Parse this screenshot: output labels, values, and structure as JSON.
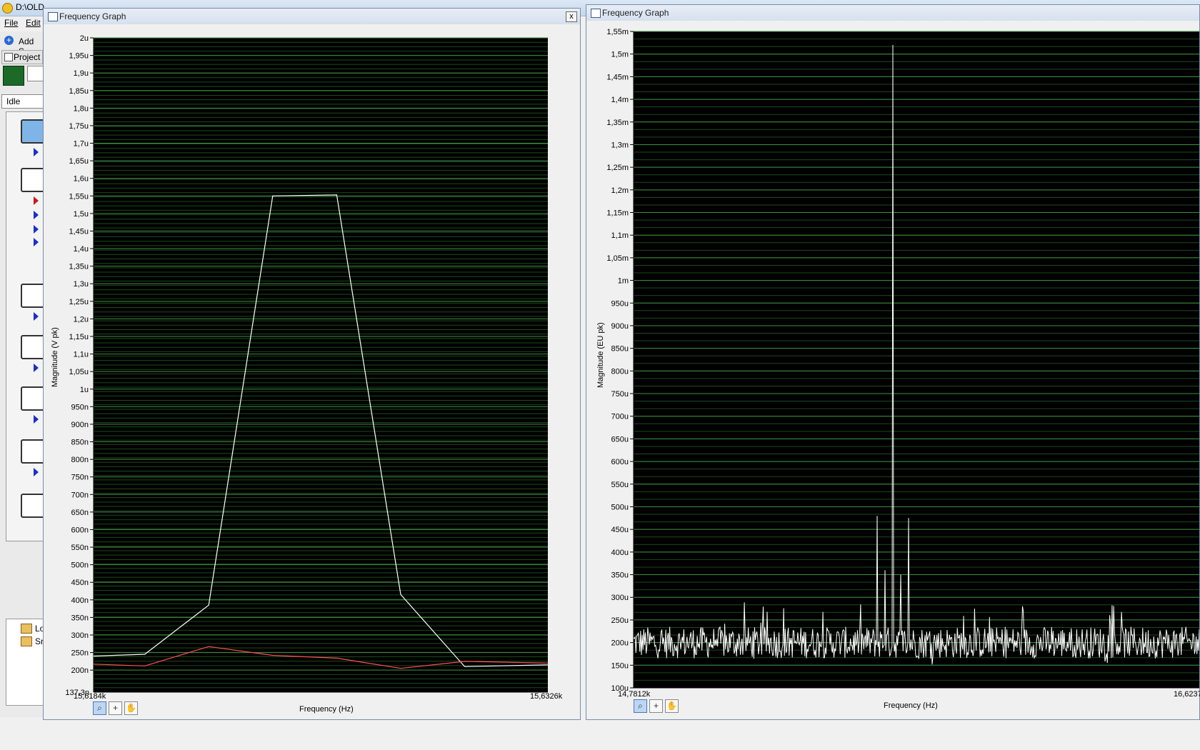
{
  "background_app": {
    "title": "D:\\OLD",
    "menu": [
      "File",
      "Edit"
    ],
    "add_button": "Add S",
    "project_tab": "Project",
    "status": "Idle",
    "tree_items": [
      "Lo",
      "Sn"
    ]
  },
  "left_window": {
    "title": "Frequency Graph",
    "close_label": "x",
    "ylabel": "Magnitude (V pk)",
    "xlabel": "Frequency (Hz)",
    "x_start_label": "15,6184k",
    "x_end_label": "15,6326k",
    "y_min_label": "137,3n",
    "tools": [
      "zoom-icon",
      "crosshair-icon",
      "hand-icon"
    ]
  },
  "right_window": {
    "title": "Frequency Graph",
    "ylabel": "Magnitude (EU pk)",
    "xlabel": "Frequency (Hz)",
    "x_start_label": "14,7812k",
    "x_end_label": "16,6237",
    "tools": [
      "zoom-icon",
      "crosshair-icon",
      "hand-icon"
    ]
  },
  "chart_data": [
    {
      "type": "line",
      "title": "Frequency Graph",
      "xlabel": "Frequency (Hz)",
      "ylabel": "Magnitude (V pk)",
      "xlim": [
        15618.4,
        15632.6
      ],
      "ylim": [
        1.373e-07,
        2e-06
      ],
      "grid": true,
      "ytick_labels": [
        "2u",
        "1,95u",
        "1,9u",
        "1,85u",
        "1,8u",
        "1,75u",
        "1,7u",
        "1,65u",
        "1,6u",
        "1,55u",
        "1,5u",
        "1,45u",
        "1,4u",
        "1,35u",
        "1,3u",
        "1,25u",
        "1,2u",
        "1,15u",
        "1,1u",
        "1,05u",
        "1u",
        "950n",
        "900n",
        "850n",
        "800n",
        "750n",
        "700n",
        "650n",
        "600n",
        "550n",
        "500n",
        "450n",
        "400n",
        "350n",
        "300n",
        "250n",
        "200n"
      ],
      "series": [
        {
          "color": "#ffffff",
          "x": [
            15618.4,
            15620.0,
            15622.0,
            15624.0,
            15626.0,
            15628.0,
            15630.0,
            15632.6
          ],
          "y": [
            2.4e-07,
            2.45e-07,
            3.85e-07,
            1.55e-06,
            1.553e-06,
            4.15e-07,
            2.1e-07,
            2.15e-07
          ]
        },
        {
          "color": "#ff5050",
          "x": [
            15618.4,
            15620.0,
            15622.0,
            15624.0,
            15626.0,
            15628.0,
            15630.0,
            15632.6
          ],
          "y": [
            2.17e-07,
            2.12e-07,
            2.67e-07,
            2.42e-07,
            2.34e-07,
            2.05e-07,
            2.25e-07,
            2.2e-07
          ]
        }
      ]
    },
    {
      "type": "line",
      "title": "Frequency Graph",
      "xlabel": "Frequency (Hz)",
      "ylabel": "Magnitude (EU pk)",
      "xlim": [
        14781.2,
        16623.7
      ],
      "ylim": [
        0.0001,
        0.00155
      ],
      "grid": true,
      "ytick_labels": [
        "1,55m",
        "1,5m",
        "1,45m",
        "1,4m",
        "1,35m",
        "1,3m",
        "1,25m",
        "1,2m",
        "1,15m",
        "1,1m",
        "1,05m",
        "1m",
        "950u",
        "900u",
        "850u",
        "800u",
        "750u",
        "700u",
        "650u",
        "600u",
        "550u",
        "500u",
        "450u",
        "400u",
        "350u",
        "300u",
        "250u",
        "200u",
        "150u",
        "100u"
      ],
      "noise_floor": [
        0.00015,
        0.00025
      ],
      "peaks": [
        {
          "x": 15625.0,
          "y": 0.00152
        },
        {
          "x": 15574.0,
          "y": 0.00048
        },
        {
          "x": 15676.0,
          "y": 0.000475
        },
        {
          "x": 15600.0,
          "y": 0.00036
        },
        {
          "x": 15652.0,
          "y": 0.00035
        }
      ],
      "series": [
        {
          "color": "#ffffff"
        }
      ]
    }
  ]
}
